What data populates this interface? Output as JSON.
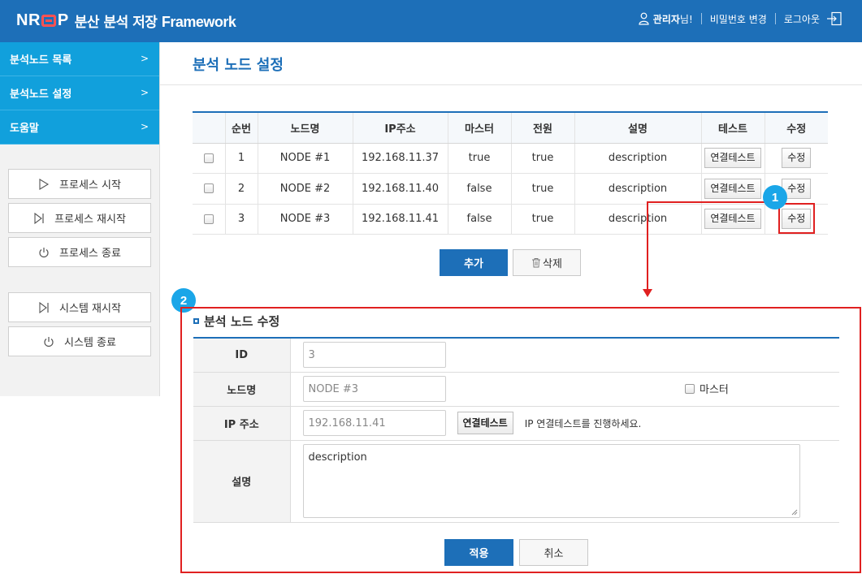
{
  "header": {
    "logo_letters": [
      "N",
      "R",
      "P"
    ],
    "logo_korean": "분산 분석 저장",
    "logo_english": "Framework",
    "user_name": "관리자",
    "user_suffix": "님!",
    "change_password": "비밀번호 변경",
    "logout": "로그아웃",
    "brand_color": "#1d6fb8"
  },
  "sidebar": {
    "items": [
      {
        "label": "분석노드 목록",
        "arrow": ">"
      },
      {
        "label": "분석노드 설정",
        "arrow": ">"
      },
      {
        "label": "도움말",
        "arrow": ">"
      }
    ],
    "process_buttons": [
      {
        "label": "프로세스 시작",
        "icon": "play-icon"
      },
      {
        "label": "프로세스 재시작",
        "icon": "restart-icon"
      },
      {
        "label": "프로세스 종료",
        "icon": "power-icon"
      }
    ],
    "system_buttons": [
      {
        "label": "시스템 재시작",
        "icon": "restart-icon"
      },
      {
        "label": "시스템 종료",
        "icon": "power-icon"
      }
    ]
  },
  "main": {
    "title": "분석 노드 설정",
    "table": {
      "headers": [
        "",
        "순번",
        "노드명",
        "IP주소",
        "마스터",
        "전원",
        "설명",
        "테스트",
        "수정"
      ],
      "rows": [
        {
          "seq": "1",
          "name": "NODE #1",
          "ip": "192.168.11.37",
          "master": "true",
          "power": "true",
          "desc": "description",
          "test": "연결테스트",
          "edit": "수정"
        },
        {
          "seq": "2",
          "name": "NODE #2",
          "ip": "192.168.11.40",
          "master": "false",
          "power": "true",
          "desc": "description",
          "test": "연결테스트",
          "edit": "수정"
        },
        {
          "seq": "3",
          "name": "NODE #3",
          "ip": "192.168.11.41",
          "master": "false",
          "power": "true",
          "desc": "description",
          "test": "연결테스트",
          "edit": "수정"
        }
      ]
    },
    "add_label": "추가",
    "delete_label": "삭제"
  },
  "callouts": [
    "1",
    "2"
  ],
  "edit_form": {
    "title": "분석 노드 수정",
    "id_label": "ID",
    "id_value": "3",
    "name_label": "노드명",
    "name_value": "NODE #3",
    "master_label": "마스터",
    "ip_label": "IP 주소",
    "ip_value": "192.168.11.41",
    "test_button": "연결테스트",
    "ip_hint": "IP 연결테스트를 진행하세요.",
    "desc_label": "설명",
    "desc_value": "description",
    "apply_label": "적용",
    "cancel_label": "취소"
  },
  "colors": {
    "highlight": "#e02020",
    "badge": "#1aa6e8",
    "nav": "#11a0dc"
  }
}
